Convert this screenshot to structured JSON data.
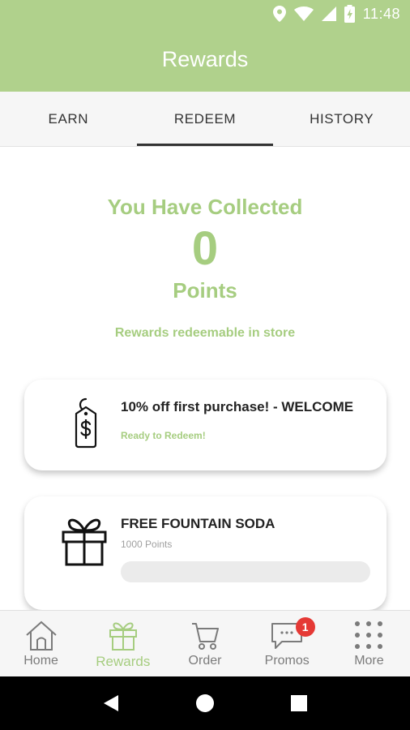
{
  "status_bar": {
    "time": "11:48"
  },
  "header": {
    "title": "Rewards"
  },
  "tabs": [
    {
      "label": "EARN",
      "active": false
    },
    {
      "label": "REDEEM",
      "active": true
    },
    {
      "label": "HISTORY",
      "active": false
    }
  ],
  "summary": {
    "heading": "You Have Collected",
    "points": "0",
    "unit": "Points",
    "note": "Rewards redeemable in store"
  },
  "rewards": [
    {
      "name": "10% off first purchase! - WELCOME",
      "status": "Ready to Redeem!",
      "icon": "price-tag-icon"
    },
    {
      "name": "FREE FOUNTAIN SODA",
      "points_required": "1000 Points",
      "progress": 0,
      "icon": "gift-icon"
    }
  ],
  "bottom_nav": [
    {
      "label": "Home",
      "icon": "home-icon",
      "active": false
    },
    {
      "label": "Rewards",
      "icon": "gift-icon",
      "active": true
    },
    {
      "label": "Order",
      "icon": "cart-icon",
      "active": false
    },
    {
      "label": "Promos",
      "icon": "chat-icon",
      "active": false,
      "badge": "1"
    },
    {
      "label": "More",
      "icon": "grid-dots-icon",
      "active": false
    }
  ],
  "colors": {
    "brand": "#b0d18c",
    "accent": "#a6cd80",
    "badge": "#e53935"
  }
}
